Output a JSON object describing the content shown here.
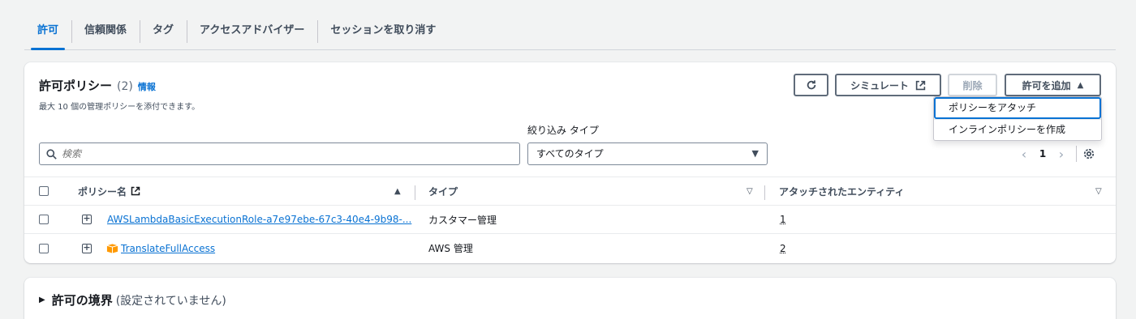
{
  "tabs": [
    {
      "label": "許可"
    },
    {
      "label": "信頼関係"
    },
    {
      "label": "タグ"
    },
    {
      "label": "アクセスアドバイザー"
    },
    {
      "label": "セッションを取り消す"
    }
  ],
  "policies": {
    "title": "許可ポリシー",
    "count": "(2)",
    "info": "情報",
    "description": "最大 10 個の管理ポリシーを添付できます。",
    "buttons": {
      "simulate": "シミュレート",
      "delete": "削除",
      "add": "許可を追加"
    },
    "add_menu": [
      "ポリシーをアタッチ",
      "インラインポリシーを作成"
    ],
    "filter_label": "絞り込み タイプ",
    "search_placeholder": "検索",
    "type_select": "すべてのタイプ",
    "page": "1",
    "columns": [
      "ポリシー名",
      "タイプ",
      "アタッチされたエンティティ"
    ],
    "rows": [
      {
        "name": "AWSLambdaBasicExecutionRole-a7e97ebe-67c3-40e4-9b98-...",
        "type": "カスタマー管理",
        "entities": "1"
      },
      {
        "name": "TranslateFullAccess",
        "type": "AWS 管理",
        "entities": "2"
      }
    ]
  },
  "boundary": {
    "title": "許可の境界",
    "status": "(設定されていません)"
  },
  "colors": {
    "accent": "#0972d3",
    "aws_orange": "#ff9900"
  }
}
